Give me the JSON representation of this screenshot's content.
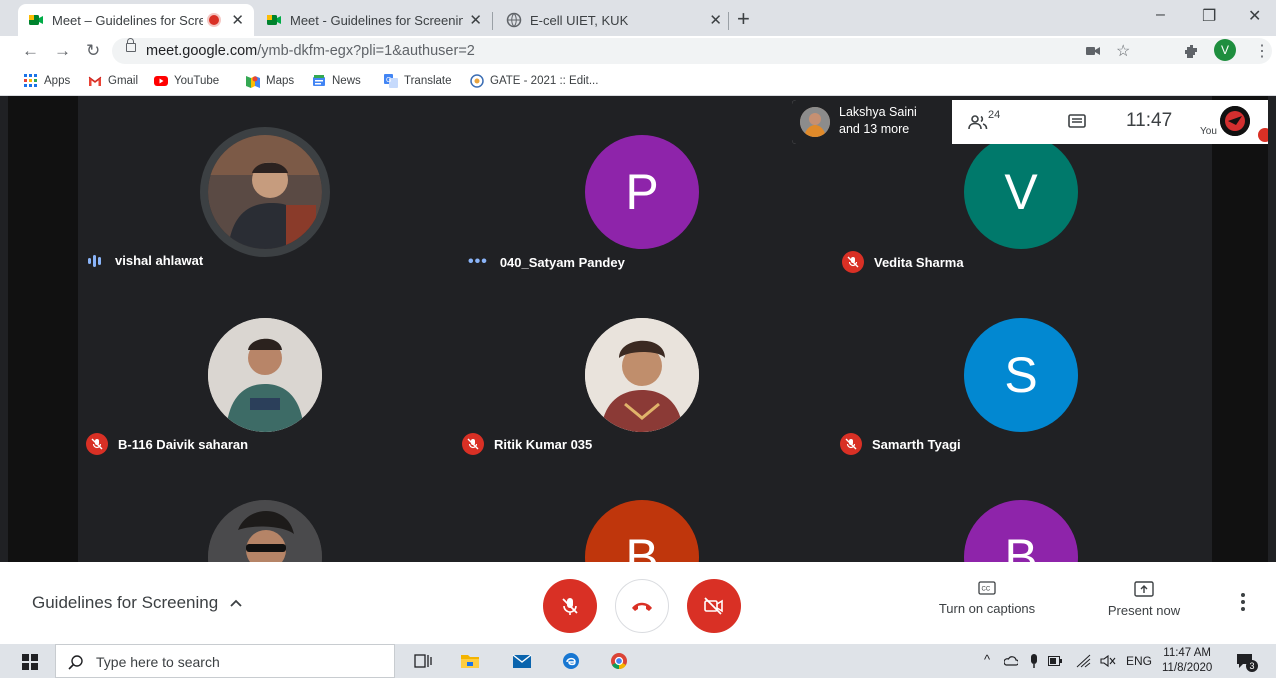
{
  "browser": {
    "tabs": [
      {
        "title": "Meet – Guidelines for Screen",
        "active": true,
        "recording": true
      },
      {
        "title": "Meet - Guidelines for Screening",
        "active": false
      },
      {
        "title": "E-cell UIET, KUK",
        "active": false
      }
    ],
    "new_tab_label": "+",
    "url_host": "meet.google.com",
    "url_path": "/ymb-dkfm-egx?pli=1&authuser=2",
    "profile_initial": "V",
    "window_controls": {
      "minimize": "–",
      "maximize": "❐",
      "close": "✕"
    }
  },
  "bookmarks": [
    {
      "label": "Apps",
      "icon": "apps-grid-icon"
    },
    {
      "label": "Gmail",
      "icon": "gmail-icon"
    },
    {
      "label": "YouTube",
      "icon": "youtube-icon"
    },
    {
      "label": "Maps",
      "icon": "maps-icon"
    },
    {
      "label": "News",
      "icon": "news-icon"
    },
    {
      "label": "Translate",
      "icon": "translate-icon"
    },
    {
      "label": "GATE - 2021 :: Edit...",
      "icon": "gate-icon"
    }
  ],
  "meeting": {
    "presenter_name": "Lakshya Saini",
    "presenter_more": "and 13 more",
    "participant_count": "24",
    "time": "11:47",
    "self_label": "You",
    "title": "Guidelines for Screening",
    "captions_label": "Turn on captions",
    "present_label": "Present now",
    "participants": [
      {
        "name": "vishal ahlawat",
        "avatar": "photo",
        "status": "speaking"
      },
      {
        "name": "040_Satyam Pandey",
        "avatar": "P",
        "color": "#8e24aa",
        "status": "connecting"
      },
      {
        "name": "Vedita Sharma",
        "avatar": "V",
        "color": "#00796b",
        "status": "muted"
      },
      {
        "name": "B-116 Daivik saharan",
        "avatar": "photo",
        "status": "muted"
      },
      {
        "name": "Ritik Kumar 035",
        "avatar": "photo",
        "status": "muted"
      },
      {
        "name": "Samarth Tyagi",
        "avatar": "S",
        "color": "#0288d1",
        "status": "muted"
      },
      {
        "name": "",
        "avatar": "photo",
        "status": ""
      },
      {
        "name": "",
        "avatar": "B",
        "color": "#bf360c",
        "status": ""
      },
      {
        "name": "",
        "avatar": "B",
        "color": "#8e24aa",
        "status": ""
      }
    ]
  },
  "taskbar": {
    "search_placeholder": "Type here to search",
    "lang": "ENG",
    "time": "11:47 AM",
    "date": "11/8/2020",
    "notifications": "3"
  }
}
